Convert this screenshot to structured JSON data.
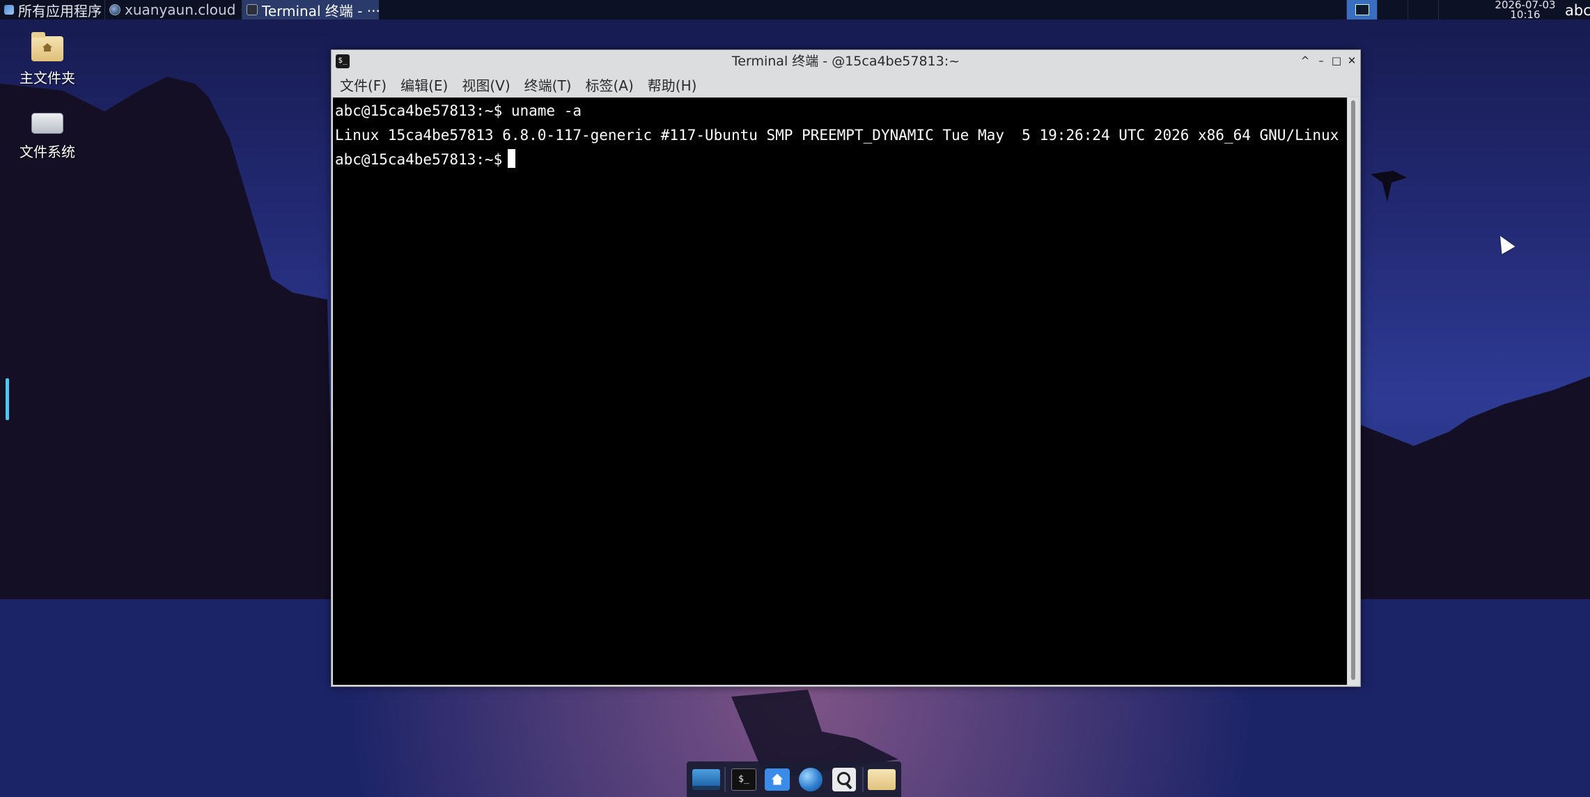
{
  "top_panel": {
    "apps_menu_label": "所有应用程序",
    "tasks": [
      {
        "label": "xuanyaun.cloud ···"
      },
      {
        "label": "Terminal 终端 - ···"
      }
    ],
    "clock": {
      "date": "2026-07-03",
      "time": "10:16"
    },
    "user": "abc"
  },
  "desktop_icons": [
    {
      "label": "主文件夹"
    },
    {
      "label": "文件系统"
    }
  ],
  "terminal": {
    "title": "Terminal 终端 - @15ca4be57813:~",
    "title_icon": "$_",
    "window_buttons": [
      "^",
      "–",
      "□",
      "✕"
    ],
    "menus": [
      "文件(F)",
      "编辑(E)",
      "视图(V)",
      "终端(T)",
      "标签(A)",
      "帮助(H)"
    ],
    "lines": [
      "abc@15ca4be57813:~$ uname -a",
      "Linux 15ca4be57813 6.8.0-117-generic #117-Ubuntu SMP PREEMPT_DYNAMIC Tue May  5 19:26:24 UTC 2026 x86_64 GNU/Linux",
      "abc@15ca4be57813:~$"
    ]
  },
  "dock": {
    "items": [
      "show-desktop",
      "terminal",
      "home-folder",
      "web-browser",
      "app-finder",
      "file-manager"
    ],
    "terminal_glyph": "$_"
  },
  "colors": {
    "panel_bg": "#0d1126",
    "active_task": "#2a3a6a",
    "terminal_bg": "#000000",
    "terminal_fg": "#ffffff",
    "window_chrome": "#dcdddf"
  }
}
